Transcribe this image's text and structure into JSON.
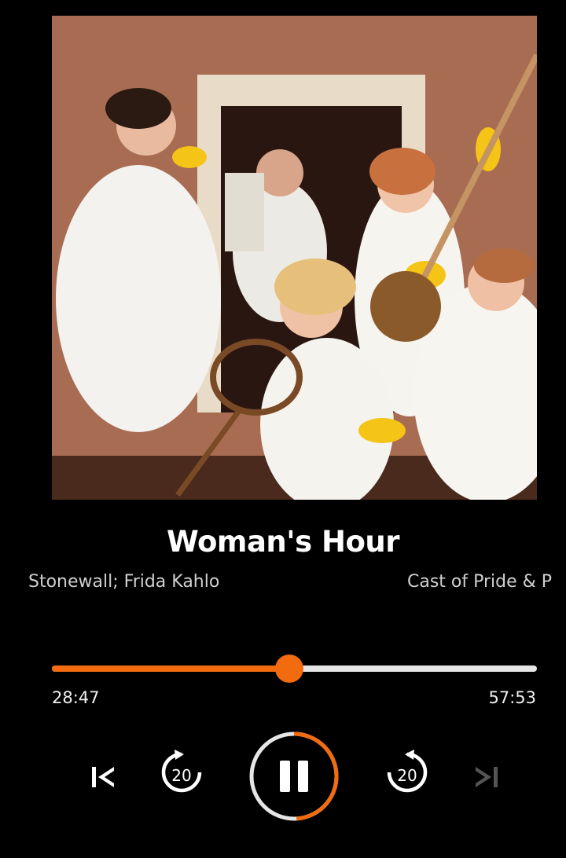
{
  "episode": {
    "title": "Woman's Hour",
    "marquee_text": "Stonewall; Frida Kahlo",
    "marquee_next": "Cast of Pride & P"
  },
  "playback": {
    "elapsed": "28:47",
    "duration": "57:53",
    "progress": 0.49,
    "state": "playing"
  },
  "controls": {
    "rewind_seconds": "20",
    "forward_seconds": "20"
  },
  "colors": {
    "accent": "#f26b0f",
    "background": "#000000",
    "track": "#e6e6e6"
  }
}
